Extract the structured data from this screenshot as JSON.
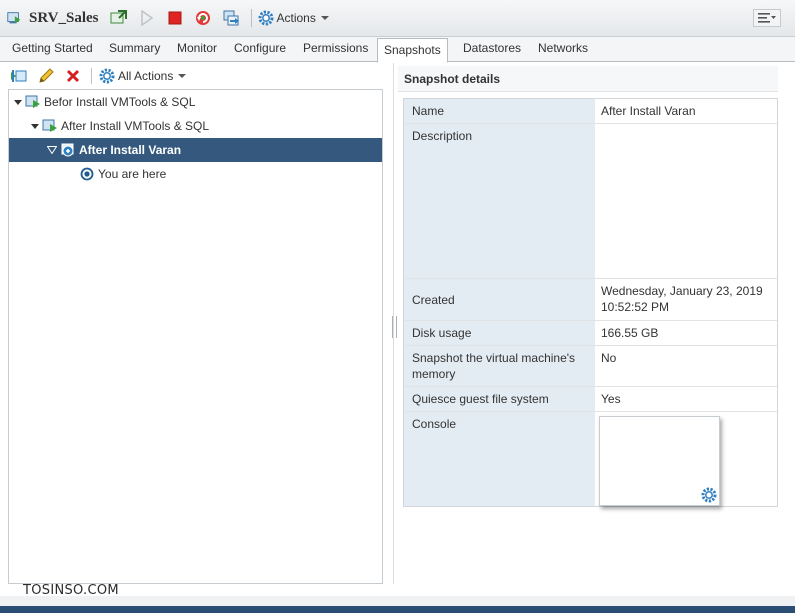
{
  "header": {
    "vm_name": "SRV_Sales",
    "actions_label": "Actions"
  },
  "tabs": [
    {
      "label": "Getting Started"
    },
    {
      "label": "Summary"
    },
    {
      "label": "Monitor"
    },
    {
      "label": "Configure"
    },
    {
      "label": "Permissions"
    },
    {
      "label": "Snapshots",
      "active": true
    },
    {
      "label": "Datastores"
    },
    {
      "label": "Networks"
    }
  ],
  "left_toolbar": {
    "all_actions_label": "All Actions"
  },
  "tree": [
    {
      "label": "Befor Install VMTools & SQL",
      "level": 0
    },
    {
      "label": "After Install VMTools & SQL",
      "level": 1
    },
    {
      "label": "After Install Varan",
      "level": 2,
      "selected": true
    },
    {
      "label": "You are here",
      "level": 3
    }
  ],
  "details": {
    "header": "Snapshot details",
    "rows": [
      {
        "key": "Name",
        "value": "After Install Varan"
      },
      {
        "key": "Description",
        "value": ""
      },
      {
        "key": "Created",
        "value": "Wednesday, January 23, 2019 10:52:52 PM"
      },
      {
        "key": "Disk usage",
        "value": "166.55 GB"
      },
      {
        "key": "Snapshot the virtual machine's memory",
        "value": "No"
      },
      {
        "key": "Quiesce guest file system",
        "value": "Yes"
      },
      {
        "key": "Console",
        "value": ""
      }
    ]
  },
  "watermark": "TOSINSO.COM",
  "colors": {
    "selection": "#34587e",
    "key_cell": "#e4ecf3",
    "icon_blue": "#2f7fc1"
  }
}
